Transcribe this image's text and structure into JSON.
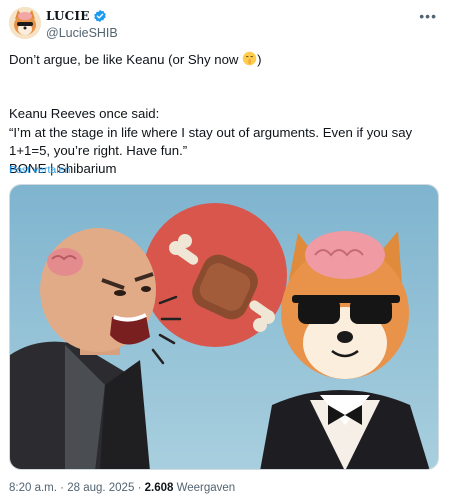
{
  "author": {
    "display_name": "LUCIE",
    "handle": "@LucieSHIB",
    "verified": true
  },
  "tweet": {
    "line1": "Don’t argue, be like Keanu (or Shy now ",
    "line1_end": ")",
    "line2": "Keanu Reeves once said:",
    "line3": "“I’m at the stage in life where I stay out of arguments. Even if you say",
    "line4": "1+1=5, you’re right. Have fun.”",
    "line5": "BONE | Shibarium",
    "translate_link": "Post vertalen"
  },
  "meta": {
    "time": "8:20 a.m.",
    "separator": "·",
    "date": "28 aug. 2025",
    "views_count": "2.608",
    "views_label": "Weergaven"
  },
  "colors": {
    "link": "#1d9bf0",
    "secondary_text": "#536471",
    "verified_badge": "#1d9bf0"
  },
  "icons": {
    "verified": "verified-badge-icon",
    "more": "more-options-icon",
    "emoji": "shushing-face-emoji"
  }
}
